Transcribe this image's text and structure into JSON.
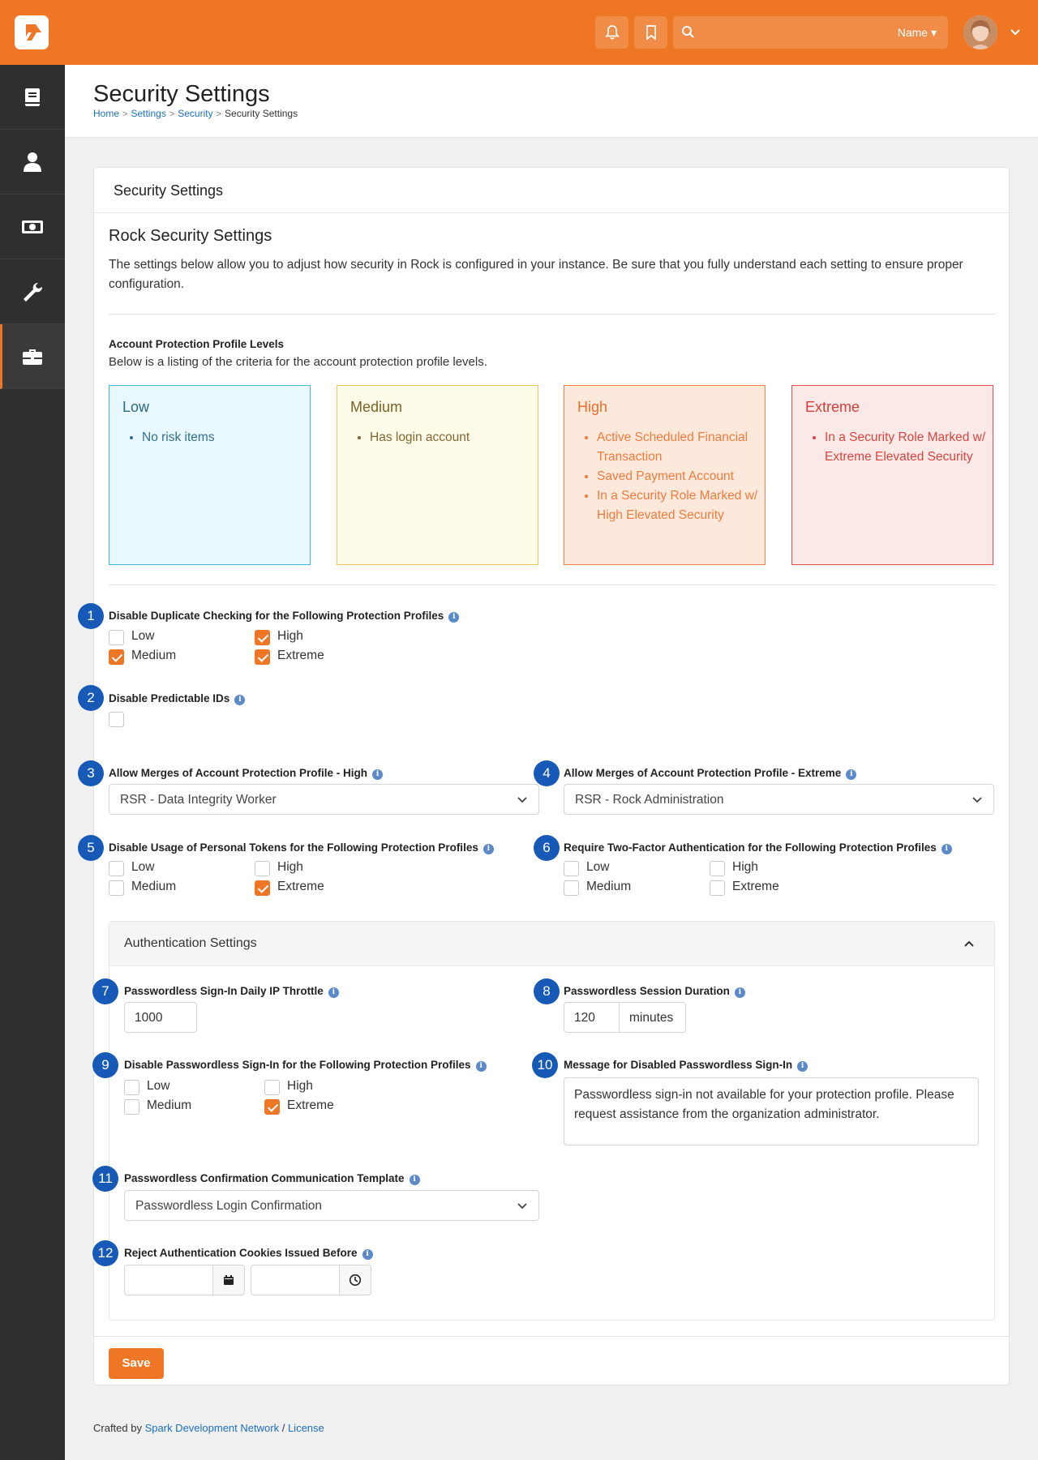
{
  "topbar": {
    "search_placeholder": "",
    "search_scope": "Name ▾",
    "colors": {
      "brand": "#ee7624"
    }
  },
  "sidebar": {
    "items": [
      {
        "icon": "book-icon",
        "active": false
      },
      {
        "icon": "person-icon",
        "active": false
      },
      {
        "icon": "money-icon",
        "active": false
      },
      {
        "icon": "wrench-icon",
        "active": false
      },
      {
        "icon": "briefcase-icon",
        "active": true
      }
    ]
  },
  "page": {
    "title": "Security Settings",
    "breadcrumb": [
      "Home",
      "Settings",
      "Security",
      "Security Settings"
    ]
  },
  "panel": {
    "title": "Security Settings",
    "section_title": "Rock Security Settings",
    "intro": "The settings below allow you to adjust how security in Rock is configured in your instance. Be sure that you fully understand each setting to ensure proper configuration.",
    "profiles_label": "Account Protection Profile Levels",
    "profiles_desc": "Below is a listing of the criteria for the account protection profile levels.",
    "profiles": {
      "low": {
        "title": "Low",
        "items": [
          "No risk items"
        ]
      },
      "medium": {
        "title": "Medium",
        "items": [
          "Has login account"
        ]
      },
      "high": {
        "title": "High",
        "items": [
          "Active Scheduled Financial Transaction",
          "Saved Payment Account",
          "In a Security Role Marked w/ High Elevated Security"
        ]
      },
      "extreme": {
        "title": "Extreme",
        "items": [
          "In a Security Role Marked w/ Extreme Elevated Security"
        ]
      }
    }
  },
  "badges": [
    "1",
    "2",
    "3",
    "4",
    "5",
    "6",
    "7",
    "8",
    "9",
    "10",
    "11",
    "12"
  ],
  "fields": {
    "dup_check": {
      "label": "Disable Duplicate Checking for the Following Protection Profiles",
      "options": {
        "low": "Low",
        "medium": "Medium",
        "high": "High",
        "extreme": "Extreme"
      },
      "checked": {
        "low": false,
        "medium": true,
        "high": true,
        "extreme": true
      }
    },
    "predictable_ids": {
      "label": "Disable Predictable IDs",
      "checked": false
    },
    "merge_high": {
      "label": "Allow Merges of Account Protection Profile - High",
      "value": "RSR - Data Integrity Worker"
    },
    "merge_extreme": {
      "label": "Allow Merges of Account Protection Profile - Extreme",
      "value": "RSR - Rock Administration"
    },
    "tokens": {
      "label": "Disable Usage of Personal Tokens for the Following Protection Profiles",
      "options": {
        "low": "Low",
        "medium": "Medium",
        "high": "High",
        "extreme": "Extreme"
      },
      "checked": {
        "low": false,
        "medium": false,
        "high": false,
        "extreme": true
      }
    },
    "two_factor": {
      "label": "Require Two-Factor Authentication for the Following Protection Profiles",
      "options": {
        "low": "Low",
        "medium": "Medium",
        "high": "High",
        "extreme": "Extreme"
      },
      "checked": {
        "low": false,
        "medium": false,
        "high": false,
        "extreme": false
      }
    }
  },
  "auth": {
    "title": "Authentication Settings",
    "ip_throttle": {
      "label": "Passwordless Sign-In Daily IP Throttle",
      "value": "1000"
    },
    "session_duration": {
      "label": "Passwordless Session Duration",
      "value": "120",
      "unit": "minutes"
    },
    "disable_passwordless": {
      "label": "Disable Passwordless Sign-In for the Following Protection Profiles",
      "options": {
        "low": "Low",
        "medium": "Medium",
        "high": "High",
        "extreme": "Extreme"
      },
      "checked": {
        "low": false,
        "medium": false,
        "high": false,
        "extreme": true
      }
    },
    "disabled_message": {
      "label": "Message for Disabled Passwordless Sign-In",
      "value": "Passwordless sign-in not available for your protection profile. Please request assistance from the organization administrator."
    },
    "confirmation_template": {
      "label": "Passwordless Confirmation Communication Template",
      "value": "Passwordless Login Confirmation"
    },
    "reject_cookies": {
      "label": "Reject Authentication Cookies Issued Before",
      "date": "",
      "time": ""
    }
  },
  "actions": {
    "save": "Save"
  },
  "footer": {
    "prefix": "Crafted by",
    "org": "Spark Development Network",
    "sep": "/",
    "license": "License"
  }
}
